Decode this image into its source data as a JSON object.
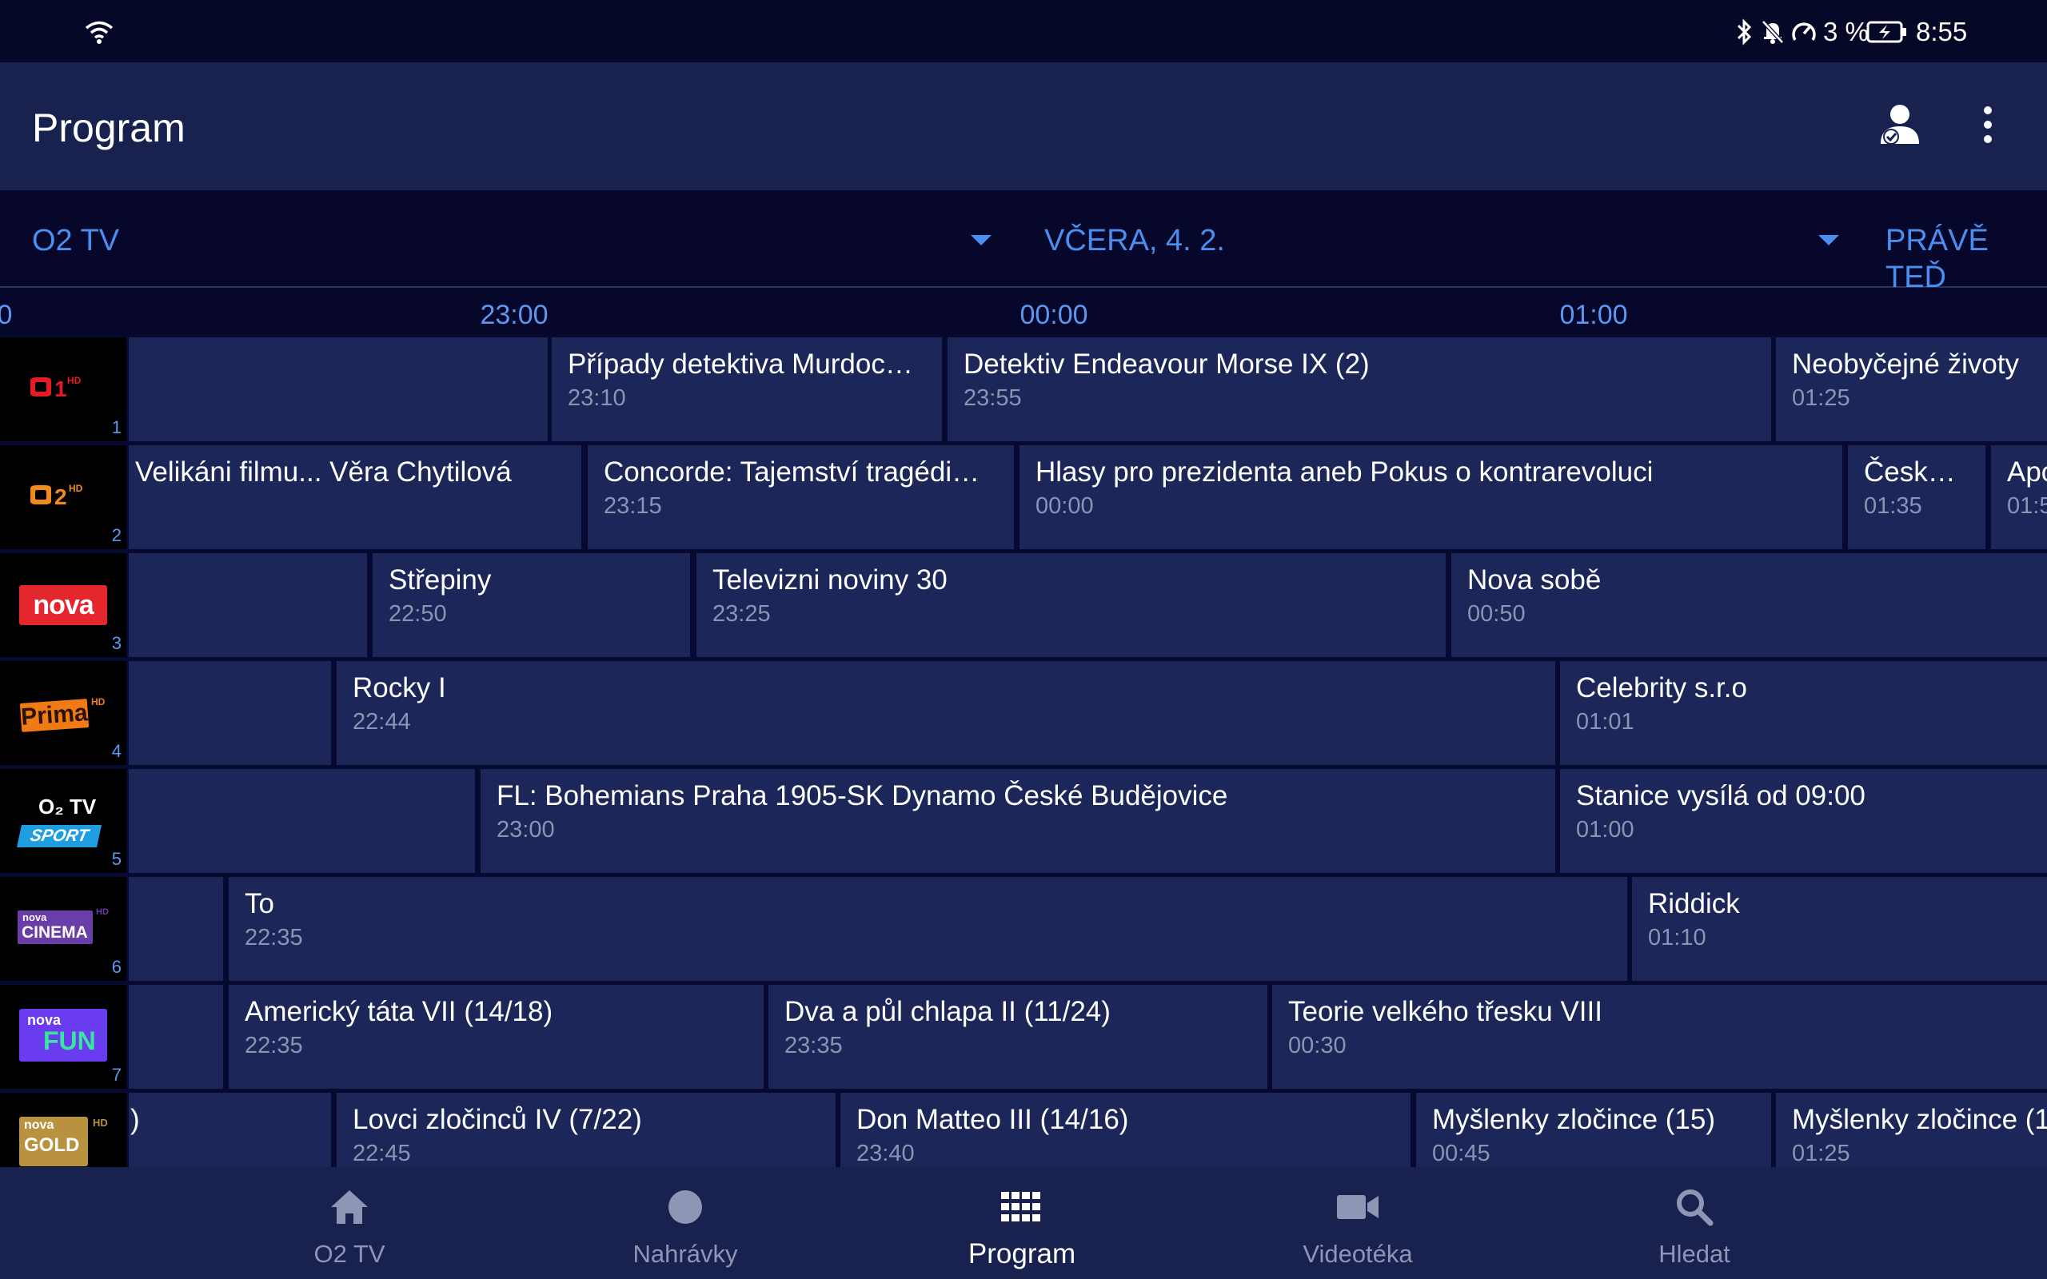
{
  "status_bar": {
    "battery_percent": "3 %",
    "time": "8:55"
  },
  "app_bar": {
    "title": "Program"
  },
  "filters": {
    "provider": "O2 TV",
    "date": "VČERA, 4. 2.",
    "now_button": "PRÁVĚ TEĎ"
  },
  "timeline": {
    "labels": [
      "0",
      "23:00",
      "00:00",
      "01:00"
    ]
  },
  "channels": [
    {
      "number": "1",
      "logo": "CT1 HD",
      "programs": [
        {
          "title": "Případy detektiva Murdoc…",
          "time": "23:10"
        },
        {
          "title": "Detektiv Endeavour Morse IX (2)",
          "time": "23:55"
        },
        {
          "title": "Neobyčejné životy",
          "time": "01:25"
        }
      ]
    },
    {
      "number": "2",
      "logo": "CT2 HD",
      "programs": [
        {
          "title": "Velikáni filmu... Věra Chytilová",
          "time": ""
        },
        {
          "title": "Concorde: Tajemství tragédi…",
          "time": "23:15"
        },
        {
          "title": "Hlasy pro prezidenta aneb Pokus o kontrarevoluci",
          "time": "00:00"
        },
        {
          "title": "Česko…",
          "time": "01:35"
        },
        {
          "title": "Apo",
          "time": "01:5"
        }
      ]
    },
    {
      "number": "3",
      "logo": "nova",
      "programs": [
        {
          "title": "Střepiny",
          "time": "22:50"
        },
        {
          "title": "Televizni noviny 30",
          "time": "23:25"
        },
        {
          "title": "Nova sobě",
          "time": "00:50"
        }
      ]
    },
    {
      "number": "4",
      "logo": "Prima HD",
      "programs": [
        {
          "title": "Rocky I",
          "time": "22:44"
        },
        {
          "title": "Celebrity s.r.o",
          "time": "01:01"
        }
      ]
    },
    {
      "number": "5",
      "logo": "O2 TV SPORT",
      "programs": [
        {
          "title": "FL: Bohemians Praha 1905-SK Dynamo České Budějovice",
          "time": "23:00"
        },
        {
          "title": "Stanice vysílá od 09:00",
          "time": "01:00"
        }
      ]
    },
    {
      "number": "6",
      "logo": "nova CINEMA HD",
      "programs": [
        {
          "title": "To",
          "time": "22:35"
        },
        {
          "title": "Riddick",
          "time": "01:10"
        }
      ]
    },
    {
      "number": "7",
      "logo": "nova FUN",
      "programs": [
        {
          "title": "Americký táta VII (14/18)",
          "time": "22:35"
        },
        {
          "title": "Dva a půl chlapa II (11/24)",
          "time": "23:35"
        },
        {
          "title": "Teorie velkého třesku VIII",
          "time": "00:30"
        }
      ]
    },
    {
      "number": "",
      "logo": "nova GOLD HD",
      "programs": [
        {
          "title": ")",
          "time": ""
        },
        {
          "title": "Lovci zločinců IV (7/22)",
          "time": "22:45"
        },
        {
          "title": "Don Matteo III (14/16)",
          "time": "23:40"
        },
        {
          "title": "Myšlenky zločince (15)",
          "time": "00:45"
        },
        {
          "title": "Myšlenky zločince (1",
          "time": "01:25"
        }
      ]
    }
  ],
  "logos": {
    "ct1": {
      "text": "1",
      "badge": "HD"
    },
    "ct2": {
      "text": "2",
      "badge": "HD"
    },
    "nova": {
      "text": "nova"
    },
    "prima": {
      "text": "Prima",
      "badge": "HD"
    },
    "o2sport": {
      "top": "O₂ TV",
      "bottom": "SPORT"
    },
    "cinema": {
      "top": "nova",
      "bottom": "CINEMA",
      "badge": "HD"
    },
    "fun": {
      "top": "nova",
      "bottom": "FUN"
    },
    "gold": {
      "top": "nova",
      "bottom": "GOLD",
      "badge": "HD"
    }
  },
  "bottom_nav": [
    {
      "label": "O2 TV",
      "icon": "home-icon",
      "active": false
    },
    {
      "label": "Nahrávky",
      "icon": "record-icon",
      "active": false
    },
    {
      "label": "Program",
      "icon": "grid-icon",
      "active": true
    },
    {
      "label": "Videotéka",
      "icon": "video-camera-icon",
      "active": false
    },
    {
      "label": "Hledat",
      "icon": "search-icon",
      "active": false
    }
  ]
}
